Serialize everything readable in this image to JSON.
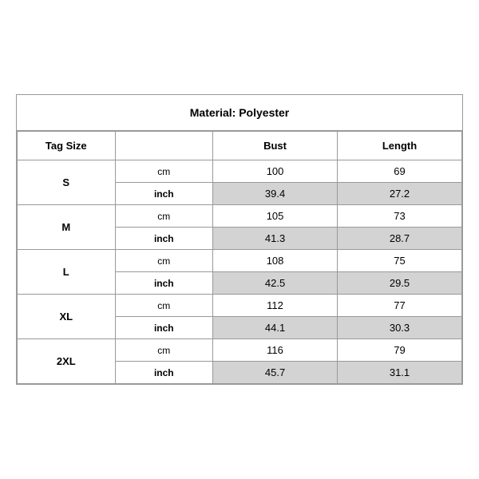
{
  "title": "Material: Polyester",
  "headers": {
    "tag_size": "Tag Size",
    "bust": "Bust",
    "length": "Length"
  },
  "rows": [
    {
      "size": "S",
      "cm": {
        "bust": "100",
        "length": "69"
      },
      "inch": {
        "bust": "39.4",
        "length": "27.2"
      }
    },
    {
      "size": "M",
      "cm": {
        "bust": "105",
        "length": "73"
      },
      "inch": {
        "bust": "41.3",
        "length": "28.7"
      }
    },
    {
      "size": "L",
      "cm": {
        "bust": "108",
        "length": "75"
      },
      "inch": {
        "bust": "42.5",
        "length": "29.5"
      }
    },
    {
      "size": "XL",
      "cm": {
        "bust": "112",
        "length": "77"
      },
      "inch": {
        "bust": "44.1",
        "length": "30.3"
      }
    },
    {
      "size": "2XL",
      "cm": {
        "bust": "116",
        "length": "79"
      },
      "inch": {
        "bust": "45.7",
        "length": "31.1"
      }
    }
  ],
  "units": {
    "cm": "cm",
    "inch": "inch"
  }
}
